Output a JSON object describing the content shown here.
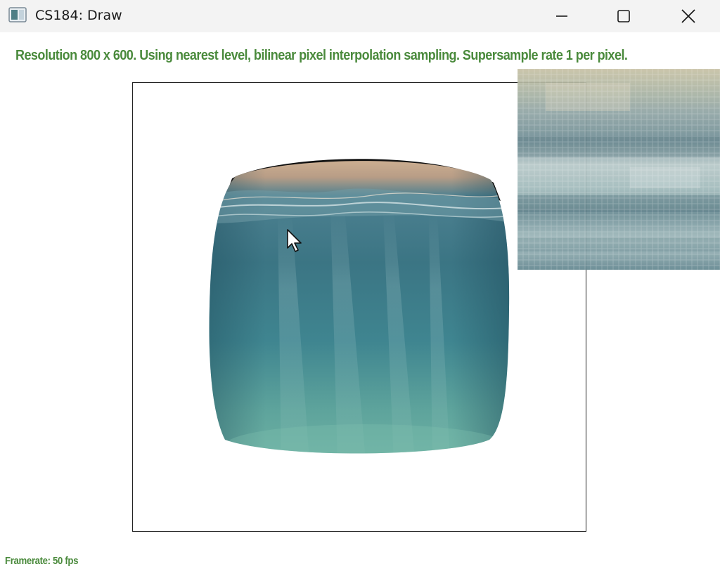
{
  "window": {
    "title": "CS184: Draw",
    "icon": "app-window-icon",
    "controls": [
      "minimize-icon",
      "maximize-icon",
      "close-icon"
    ]
  },
  "status": {
    "text": "Resolution 800 x 600. Using nearest level, bilinear pixel interpolation sampling. Supersample rate 1 per pixel."
  },
  "footer": {
    "framerate": "Framerate: 50 fps"
  },
  "colors": {
    "status_green": "#4a8a3c",
    "titlebar_bg": "#f3f3f3",
    "water_top": "#c9a88a",
    "water_mid": "#3f7f8c",
    "water_bottom": "#6fb5a8"
  },
  "canvas": {
    "content": "warped underwater texture quad",
    "cursor": "arrow-cursor-icon"
  }
}
